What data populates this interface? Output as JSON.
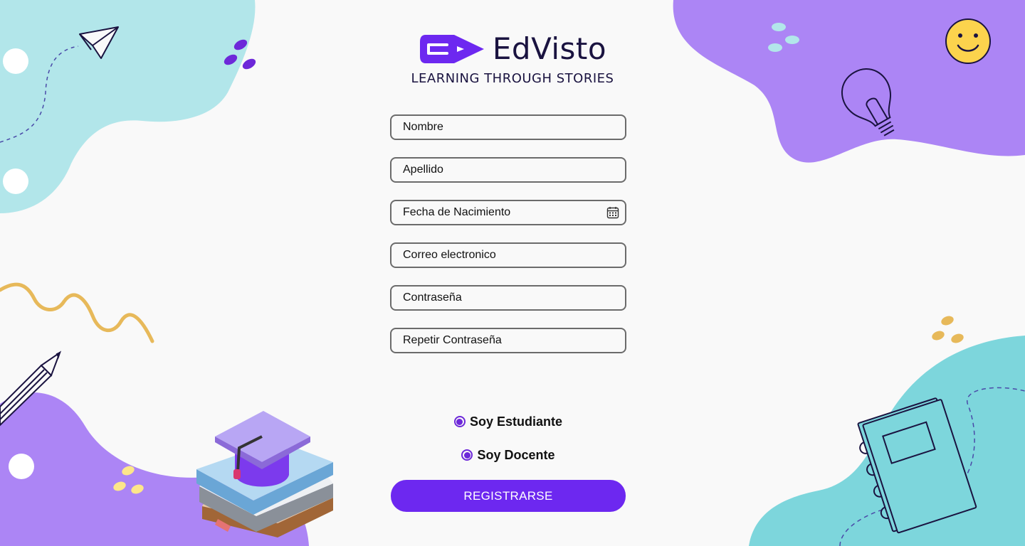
{
  "brand": {
    "name": "EdVisto",
    "tagline": "LEARNING THROUGH STORIES",
    "logo_color": "#6d28f0"
  },
  "form": {
    "fields": [
      {
        "placeholder": "Nombre",
        "type": "text"
      },
      {
        "placeholder": "Apellido",
        "type": "text"
      },
      {
        "placeholder": "Fecha de Nacimiento",
        "type": "text",
        "icon": "calendar-icon"
      },
      {
        "placeholder": "Correo electronico",
        "type": "email"
      },
      {
        "placeholder": "Contraseña",
        "type": "password"
      },
      {
        "placeholder": "Repetir Contraseña",
        "type": "password"
      }
    ]
  },
  "roles": {
    "student_label": "Soy Estudiante",
    "teacher_label": "Soy Docente"
  },
  "register_button": "REGISTRARSE",
  "colors": {
    "primary": "#6d28f0",
    "teal_blob": "#b2e6ea",
    "purple_blob": "#ac85f5",
    "accent_yellow": "#e7b95a"
  }
}
